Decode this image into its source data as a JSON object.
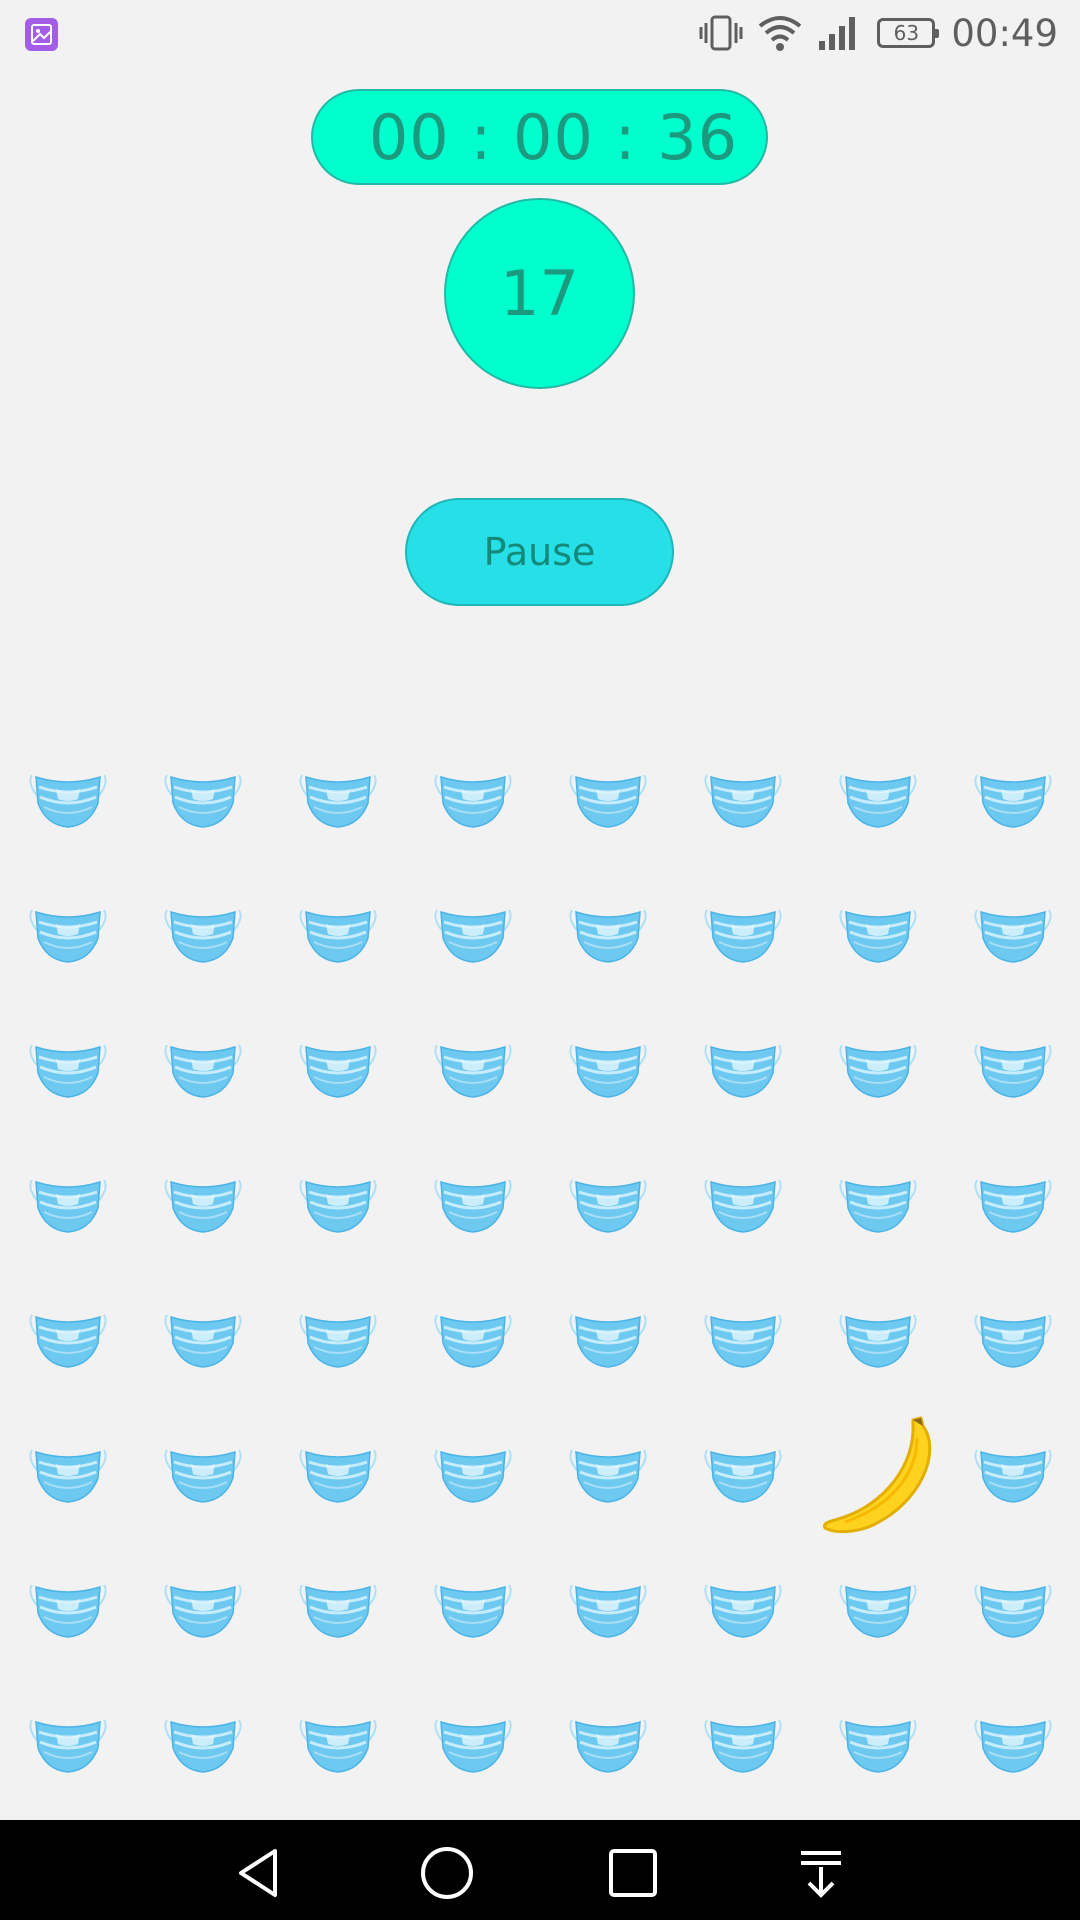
{
  "status_bar": {
    "app_icon": "image-app-icon",
    "icons": [
      "vibrate-icon",
      "wifi-icon",
      "signal-icon"
    ],
    "battery": "63",
    "time": "00:49"
  },
  "game": {
    "timer": "00 : 00 : 36",
    "score": "17",
    "pause_label": "Pause"
  },
  "board": {
    "rows": 8,
    "cols": 8,
    "default_item": "mask-icon",
    "special": [
      {
        "row": 5,
        "col": 6,
        "item": "banana-icon"
      }
    ]
  },
  "nav_bar": {
    "buttons": [
      "back-icon",
      "home-icon",
      "recents-icon",
      "notification-pull-icon"
    ]
  },
  "colors": {
    "accent": "#00ffcc",
    "pause": "#26dfe7",
    "text_accent": "#1b9a80"
  }
}
